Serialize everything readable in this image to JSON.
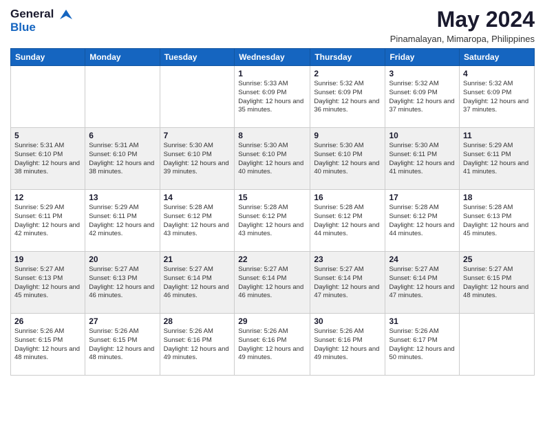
{
  "header": {
    "logo_line1": "General",
    "logo_line2": "Blue",
    "month_year": "May 2024",
    "location": "Pinamalayan, Mimaropa, Philippines"
  },
  "days_of_week": [
    "Sunday",
    "Monday",
    "Tuesday",
    "Wednesday",
    "Thursday",
    "Friday",
    "Saturday"
  ],
  "weeks": [
    [
      {
        "day": "",
        "info": ""
      },
      {
        "day": "",
        "info": ""
      },
      {
        "day": "",
        "info": ""
      },
      {
        "day": "1",
        "info": "Sunrise: 5:33 AM\nSunset: 6:09 PM\nDaylight: 12 hours\nand 35 minutes."
      },
      {
        "day": "2",
        "info": "Sunrise: 5:32 AM\nSunset: 6:09 PM\nDaylight: 12 hours\nand 36 minutes."
      },
      {
        "day": "3",
        "info": "Sunrise: 5:32 AM\nSunset: 6:09 PM\nDaylight: 12 hours\nand 37 minutes."
      },
      {
        "day": "4",
        "info": "Sunrise: 5:32 AM\nSunset: 6:09 PM\nDaylight: 12 hours\nand 37 minutes."
      }
    ],
    [
      {
        "day": "5",
        "info": "Sunrise: 5:31 AM\nSunset: 6:10 PM\nDaylight: 12 hours\nand 38 minutes."
      },
      {
        "day": "6",
        "info": "Sunrise: 5:31 AM\nSunset: 6:10 PM\nDaylight: 12 hours\nand 38 minutes."
      },
      {
        "day": "7",
        "info": "Sunrise: 5:30 AM\nSunset: 6:10 PM\nDaylight: 12 hours\nand 39 minutes."
      },
      {
        "day": "8",
        "info": "Sunrise: 5:30 AM\nSunset: 6:10 PM\nDaylight: 12 hours\nand 40 minutes."
      },
      {
        "day": "9",
        "info": "Sunrise: 5:30 AM\nSunset: 6:10 PM\nDaylight: 12 hours\nand 40 minutes."
      },
      {
        "day": "10",
        "info": "Sunrise: 5:30 AM\nSunset: 6:11 PM\nDaylight: 12 hours\nand 41 minutes."
      },
      {
        "day": "11",
        "info": "Sunrise: 5:29 AM\nSunset: 6:11 PM\nDaylight: 12 hours\nand 41 minutes."
      }
    ],
    [
      {
        "day": "12",
        "info": "Sunrise: 5:29 AM\nSunset: 6:11 PM\nDaylight: 12 hours\nand 42 minutes."
      },
      {
        "day": "13",
        "info": "Sunrise: 5:29 AM\nSunset: 6:11 PM\nDaylight: 12 hours\nand 42 minutes."
      },
      {
        "day": "14",
        "info": "Sunrise: 5:28 AM\nSunset: 6:12 PM\nDaylight: 12 hours\nand 43 minutes."
      },
      {
        "day": "15",
        "info": "Sunrise: 5:28 AM\nSunset: 6:12 PM\nDaylight: 12 hours\nand 43 minutes."
      },
      {
        "day": "16",
        "info": "Sunrise: 5:28 AM\nSunset: 6:12 PM\nDaylight: 12 hours\nand 44 minutes."
      },
      {
        "day": "17",
        "info": "Sunrise: 5:28 AM\nSunset: 6:12 PM\nDaylight: 12 hours\nand 44 minutes."
      },
      {
        "day": "18",
        "info": "Sunrise: 5:28 AM\nSunset: 6:13 PM\nDaylight: 12 hours\nand 45 minutes."
      }
    ],
    [
      {
        "day": "19",
        "info": "Sunrise: 5:27 AM\nSunset: 6:13 PM\nDaylight: 12 hours\nand 45 minutes."
      },
      {
        "day": "20",
        "info": "Sunrise: 5:27 AM\nSunset: 6:13 PM\nDaylight: 12 hours\nand 46 minutes."
      },
      {
        "day": "21",
        "info": "Sunrise: 5:27 AM\nSunset: 6:14 PM\nDaylight: 12 hours\nand 46 minutes."
      },
      {
        "day": "22",
        "info": "Sunrise: 5:27 AM\nSunset: 6:14 PM\nDaylight: 12 hours\nand 46 minutes."
      },
      {
        "day": "23",
        "info": "Sunrise: 5:27 AM\nSunset: 6:14 PM\nDaylight: 12 hours\nand 47 minutes."
      },
      {
        "day": "24",
        "info": "Sunrise: 5:27 AM\nSunset: 6:14 PM\nDaylight: 12 hours\nand 47 minutes."
      },
      {
        "day": "25",
        "info": "Sunrise: 5:27 AM\nSunset: 6:15 PM\nDaylight: 12 hours\nand 48 minutes."
      }
    ],
    [
      {
        "day": "26",
        "info": "Sunrise: 5:26 AM\nSunset: 6:15 PM\nDaylight: 12 hours\nand 48 minutes."
      },
      {
        "day": "27",
        "info": "Sunrise: 5:26 AM\nSunset: 6:15 PM\nDaylight: 12 hours\nand 48 minutes."
      },
      {
        "day": "28",
        "info": "Sunrise: 5:26 AM\nSunset: 6:16 PM\nDaylight: 12 hours\nand 49 minutes."
      },
      {
        "day": "29",
        "info": "Sunrise: 5:26 AM\nSunset: 6:16 PM\nDaylight: 12 hours\nand 49 minutes."
      },
      {
        "day": "30",
        "info": "Sunrise: 5:26 AM\nSunset: 6:16 PM\nDaylight: 12 hours\nand 49 minutes."
      },
      {
        "day": "31",
        "info": "Sunrise: 5:26 AM\nSunset: 6:17 PM\nDaylight: 12 hours\nand 50 minutes."
      },
      {
        "day": "",
        "info": ""
      }
    ]
  ]
}
